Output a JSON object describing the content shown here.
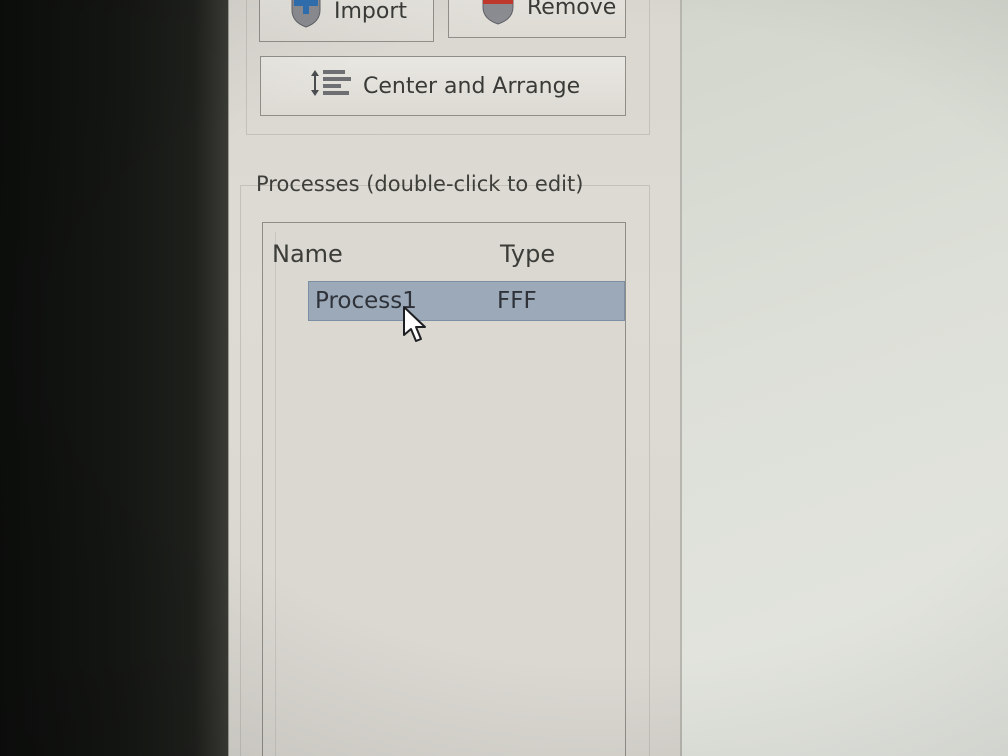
{
  "toolbar": {
    "import_label": "Import",
    "import_icon": "plus-shield-icon",
    "remove_label": "Remove",
    "remove_icon": "minus-shield-icon",
    "arrange_label": "Center and Arrange",
    "arrange_icon": "center-arrange-icon"
  },
  "processes": {
    "section_label": "Processes (double-click to edit)",
    "columns": [
      "Name",
      "Type"
    ],
    "rows": [
      {
        "name": "Process1",
        "type": "FFF",
        "selected": true
      }
    ]
  },
  "colors": {
    "selection": "#9ba9b9",
    "import_accent": "#2f6fb0",
    "remove_accent": "#c0392b"
  }
}
